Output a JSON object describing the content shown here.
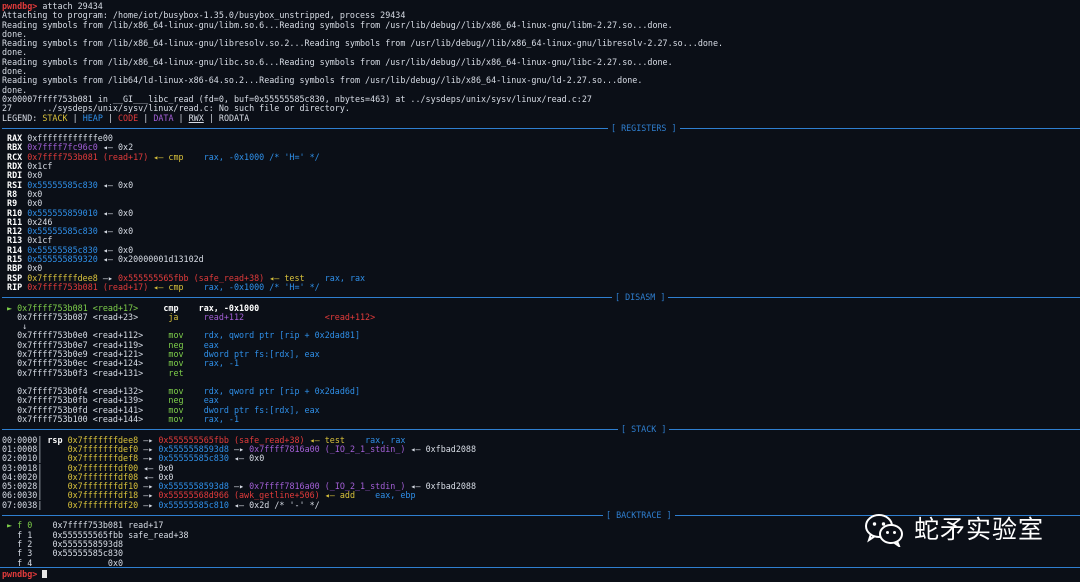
{
  "header": [
    "attach 29434",
    "Attaching to program: /home/iot/busybox-1.35.0/busybox_unstripped, process 29434",
    "Reading symbols from /lib/x86_64-linux-gnu/libm.so.6...Reading symbols from /usr/lib/debug//lib/x86_64-linux-gnu/libm-2.27.so...done.",
    "done.",
    "Reading symbols from /lib/x86_64-linux-gnu/libresolv.so.2...Reading symbols from /usr/lib/debug//lib/x86_64-linux-gnu/libresolv-2.27.so...done.",
    "done.",
    "Reading symbols from /lib/x86_64-linux-gnu/libc.so.6...Reading symbols from /usr/lib/debug//lib/x86_64-linux-gnu/libc-2.27.so...done.",
    "done.",
    "Reading symbols from /lib64/ld-linux-x86-64.so.2...Reading symbols from /usr/lib/debug//lib/x86_64-linux-gnu/ld-2.27.so...done.",
    "done.",
    "0x00007ffff753b081 in __GI___libc_read (fd=0, buf=0x55555585c830, nbytes=463) at ../sysdeps/unix/sysv/linux/read.c:27",
    "27      ../sysdeps/unix/sysv/linux/read.c: No such file or directory."
  ],
  "prompt": "pwndbg>",
  "legend": {
    "label": "LEGEND:",
    "items": [
      "STACK",
      "HEAP",
      "CODE",
      "DATA",
      "RWX",
      "RODATA"
    ],
    "sep": "|"
  },
  "sections": {
    "registers": "[ REGISTERS ]",
    "disasm": "[ DISASM ]",
    "stack": "[ STACK ]",
    "backtrace": "[ BACKTRACE ]"
  },
  "registers": {
    "RAX": "0xffffffffffffe00",
    "RBX": "0x7ffff7fc96c0",
    "RBX_deref": "◂— 0x2",
    "RCX": "0x7ffff753b081 (read+17)",
    "RCX_deref": "◂— cmp",
    "RCX_ops": "rax, -0x1000 /* 'H=' */",
    "RDX": "0x1cf",
    "RDI": "0x0",
    "RSI": "0x55555585c830",
    "RSI_deref": "◂— 0x0",
    "R8": "0x0",
    "R9": "0x0",
    "R10": "0x555555859010",
    "R10_deref": "◂— 0x0",
    "R11": "0x246",
    "R12": "0x55555585c830",
    "R12_deref": "◂— 0x0",
    "R13": "0x1cf",
    "R14": "0x55555585c830",
    "R14_deref": "◂— 0x0",
    "R15": "0x555555859320",
    "R15_deref": "◂— 0x20000001d13102d",
    "RBP": "0x0",
    "RSP": "0x7fffffffdee8",
    "RSP_arrow": "—▸",
    "RSP_target": "0x555555565fbb (safe_read+38)",
    "RSP_deref": "◂— test",
    "RSP_ops": "rax, rax",
    "RIP": "0x7ffff753b081 (read+17)",
    "RIP_deref": "◂— cmp",
    "RIP_ops": "rax, -0x1000 /* 'H=' */"
  },
  "disasm": {
    "current": {
      "marker": "►",
      "addr": "0x7ffff753b081 <read+17>",
      "mn": "cmp",
      "ops": "rax, -0x1000"
    },
    "next": {
      "addr": "0x7ffff753b087 <read+23>",
      "mn": "ja",
      "ops": "read+112",
      "target": "<read+112>"
    },
    "down_arrow": "↓",
    "block1": [
      {
        "addr": "0x7ffff753b0e0 <read+112>",
        "mn": "mov",
        "ops": "rdx, qword ptr [rip + 0x2dad81]"
      },
      {
        "addr": "0x7ffff753b0e7 <read+119>",
        "mn": "neg",
        "ops": "eax"
      },
      {
        "addr": "0x7ffff753b0e9 <read+121>",
        "mn": "mov",
        "ops": "dword ptr fs:[rdx], eax"
      },
      {
        "addr": "0x7ffff753b0ec <read+124>",
        "mn": "mov",
        "ops": "rax, -1"
      },
      {
        "addr": "0x7ffff753b0f3 <read+131>",
        "mn": "ret",
        "ops": ""
      }
    ],
    "block2": [
      {
        "addr": "0x7ffff753b0f4 <read+132>",
        "mn": "mov",
        "ops": "rdx, qword ptr [rip + 0x2dad6d]"
      },
      {
        "addr": "0x7ffff753b0fb <read+139>",
        "mn": "neg",
        "ops": "eax"
      },
      {
        "addr": "0x7ffff753b0fd <read+141>",
        "mn": "mov",
        "ops": "dword ptr fs:[rdx], eax"
      },
      {
        "addr": "0x7ffff753b100 <read+144>",
        "mn": "mov",
        "ops": "rax, -1"
      }
    ]
  },
  "stack": [
    {
      "off": "00:0000",
      "reg": "rsp",
      "addr": "0x7fffffffdee8",
      "chain": [
        {
          "t": "0x555555565fbb (safe_read+38)",
          "c": "red"
        }
      ],
      "tail": "◂— test",
      "ops": "rax, rax"
    },
    {
      "off": "01:0008",
      "reg": "",
      "addr": "0x7fffffffdef0",
      "chain": [
        {
          "t": "0x5555558593d8",
          "c": "blue"
        },
        {
          "t": "0x7ffff7816a00 (_IO_2_1_stdin_)",
          "c": "purple"
        }
      ],
      "tail": "◂— 0xfbad2088",
      "ops": ""
    },
    {
      "off": "02:0010",
      "reg": "",
      "addr": "0x7fffffffdef8",
      "chain": [
        {
          "t": "0x55555585c830",
          "c": "blue"
        }
      ],
      "tail": "◂— 0x0",
      "ops": ""
    },
    {
      "off": "03:0018",
      "reg": "",
      "addr": "0x7fffffffdf00",
      "chain": [],
      "tail": "◂— 0x0",
      "ops": ""
    },
    {
      "off": "04:0020",
      "reg": "",
      "addr": "0x7fffffffdf08",
      "chain": [],
      "tail": "◂— 0x0",
      "ops": ""
    },
    {
      "off": "05:0028",
      "reg": "",
      "addr": "0x7fffffffdf10",
      "chain": [
        {
          "t": "0x5555558593d8",
          "c": "blue"
        },
        {
          "t": "0x7ffff7816a00 (_IO_2_1_stdin_)",
          "c": "purple"
        }
      ],
      "tail": "◂— 0xfbad2088",
      "ops": ""
    },
    {
      "off": "06:0030",
      "reg": "",
      "addr": "0x7fffffffdf18",
      "chain": [
        {
          "t": "0x55555568d966 (awk_getline+506)",
          "c": "red"
        }
      ],
      "tail": "◂— add",
      "ops": "eax, ebp"
    },
    {
      "off": "07:0038",
      "reg": "",
      "addr": "0x7fffffffdf20",
      "chain": [
        {
          "t": "0x55555585c810",
          "c": "blue"
        }
      ],
      "tail": "◂— 0x2d /* '-' */",
      "ops": ""
    }
  ],
  "backtrace": [
    {
      "mark": "►",
      "frame": "f 0",
      "addr": "0x7ffff753b081",
      "sym": "read+17"
    },
    {
      "mark": "",
      "frame": "f 1",
      "addr": "0x555555565fbb",
      "sym": "safe_read+38"
    },
    {
      "mark": "",
      "frame": "f 2",
      "addr": "0x5555558593d8",
      "sym": ""
    },
    {
      "mark": "",
      "frame": "f 3",
      "addr": "0x55555585c830",
      "sym": ""
    },
    {
      "mark": "",
      "frame": "f 4",
      "addr": "0x0",
      "sym": ""
    }
  ],
  "watermark": {
    "text": "蛇矛实验室",
    "icon": "wechat-icon"
  },
  "colors": {
    "red": "#e23b3b",
    "blue": "#2f8fe8",
    "purple": "#a35fd6",
    "yellow": "#d9c23b",
    "green": "#7ecf4a",
    "rule": "#2f7fd0"
  }
}
